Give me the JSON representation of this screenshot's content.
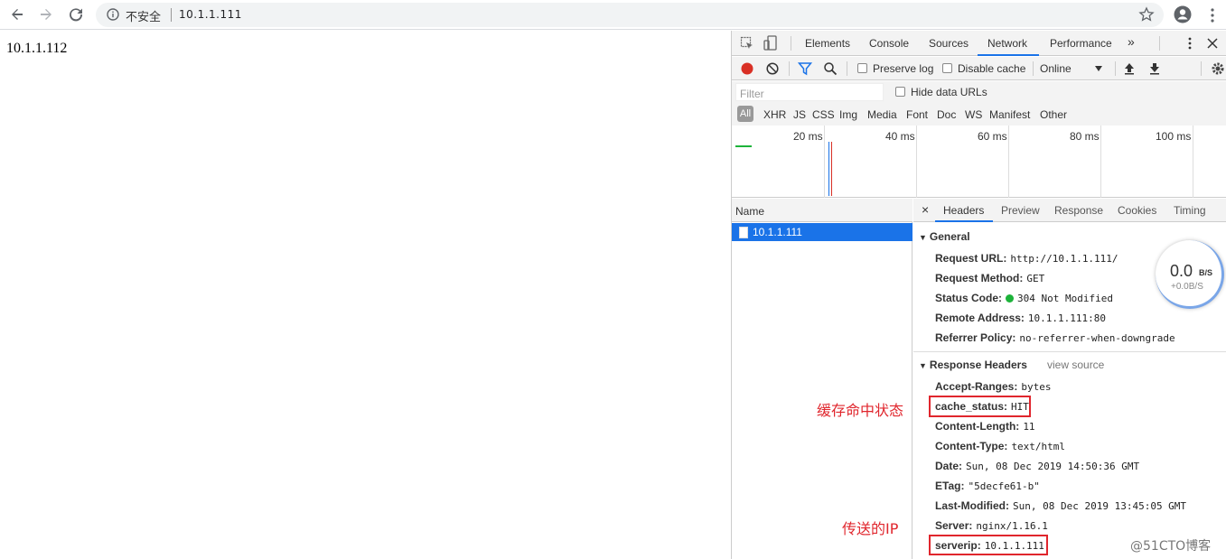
{
  "browser": {
    "security_label": "不安全",
    "url": "10.1.1.111"
  },
  "page": {
    "body_text": "10.1.1.112"
  },
  "devtools": {
    "tabs": [
      "Elements",
      "Console",
      "Sources",
      "Network",
      "Performance"
    ],
    "active_tab": "Network",
    "more_tabs": "»",
    "toolbar": {
      "preserve_log": "Preserve log",
      "disable_cache": "Disable cache",
      "throttle": "Online"
    },
    "filter": {
      "placeholder": "Filter",
      "hide_data_urls": "Hide data URLs",
      "types": [
        "All",
        "XHR",
        "JS",
        "CSS",
        "Img",
        "Media",
        "Font",
        "Doc",
        "WS",
        "Manifest",
        "Other"
      ]
    },
    "timeline_ticks": [
      "20 ms",
      "40 ms",
      "60 ms",
      "80 ms",
      "100 ms"
    ],
    "name_header": "Name",
    "request_name": "10.1.1.111",
    "detail_tabs": [
      "Headers",
      "Preview",
      "Response",
      "Cookies",
      "Timing"
    ],
    "close": "×",
    "general": {
      "title": "General",
      "rows": [
        {
          "key": "Request URL:",
          "value": "http://10.1.1.111/"
        },
        {
          "key": "Request Method:",
          "value": "GET"
        },
        {
          "key": "Status Code:",
          "value": "304 Not Modified"
        },
        {
          "key": "Remote Address:",
          "value": "10.1.1.111:80"
        },
        {
          "key": "Referrer Policy:",
          "value": "no-referrer-when-downgrade"
        }
      ]
    },
    "response_headers": {
      "title": "Response Headers",
      "view_source": "view source",
      "rows": [
        {
          "key": "Accept-Ranges:",
          "value": "bytes"
        },
        {
          "key": "cache_status:",
          "value": "HIT"
        },
        {
          "key": "Content-Length:",
          "value": "11"
        },
        {
          "key": "Content-Type:",
          "value": "text/html"
        },
        {
          "key": "Date:",
          "value": "Sun, 08 Dec 2019 14:50:36 GMT"
        },
        {
          "key": "ETag:",
          "value": "\"5decfe61-b\""
        },
        {
          "key": "Last-Modified:",
          "value": "Sun, 08 Dec 2019 13:45:05 GMT"
        },
        {
          "key": "Server:",
          "value": "nginx/1.16.1"
        },
        {
          "key": "serverip:",
          "value": "10.1.1.111"
        }
      ]
    }
  },
  "speed_widget": {
    "main": "0.0",
    "unit": "B/S",
    "sub": "+0.0B/S"
  },
  "annotations": {
    "cache": "缓存命中状态",
    "ip": "传送的IP"
  },
  "watermark": "@51CTO博客",
  "colors": {
    "accent": "#1a73e8",
    "annotation_red": "#e0262d",
    "status_green": "#1db33a"
  }
}
